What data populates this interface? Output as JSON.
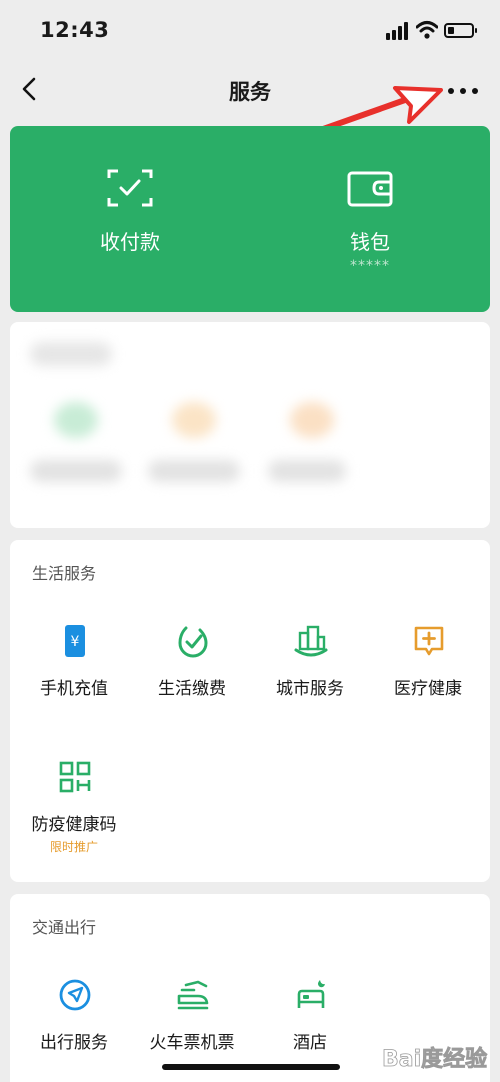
{
  "status_bar": {
    "time": "12:43"
  },
  "nav": {
    "title": "服务"
  },
  "pay_card": {
    "items": [
      {
        "label": "收付款",
        "icon": "scan-pay-icon",
        "sub": ""
      },
      {
        "label": "钱包",
        "icon": "wallet-icon",
        "sub": "*****"
      }
    ],
    "background": "#2aae67"
  },
  "sections": [
    {
      "title": "生活服务",
      "items": [
        {
          "label": "手机充值",
          "icon": "phone-recharge-icon",
          "color": "#1b8fe0",
          "tag": ""
        },
        {
          "label": "生活缴费",
          "icon": "utility-bill-icon",
          "color": "#2aae67",
          "tag": ""
        },
        {
          "label": "城市服务",
          "icon": "city-service-icon",
          "color": "#2aae67",
          "tag": ""
        },
        {
          "label": "医疗健康",
          "icon": "medical-health-icon",
          "color": "#e69c2d",
          "tag": ""
        },
        {
          "label": "防疫健康码",
          "icon": "health-code-icon",
          "color": "#2aae67",
          "tag": "限时推广"
        }
      ]
    },
    {
      "title": "交通出行",
      "items": [
        {
          "label": "出行服务",
          "icon": "travel-service-icon",
          "color": "#1b8fe0",
          "tag": ""
        },
        {
          "label": "火车票机票",
          "icon": "train-ticket-icon",
          "color": "#2aae67",
          "tag": ""
        },
        {
          "label": "酒店",
          "icon": "hotel-icon",
          "color": "#2aae67",
          "tag": ""
        }
      ]
    }
  ],
  "watermark": {
    "text": "Bai度经验"
  }
}
